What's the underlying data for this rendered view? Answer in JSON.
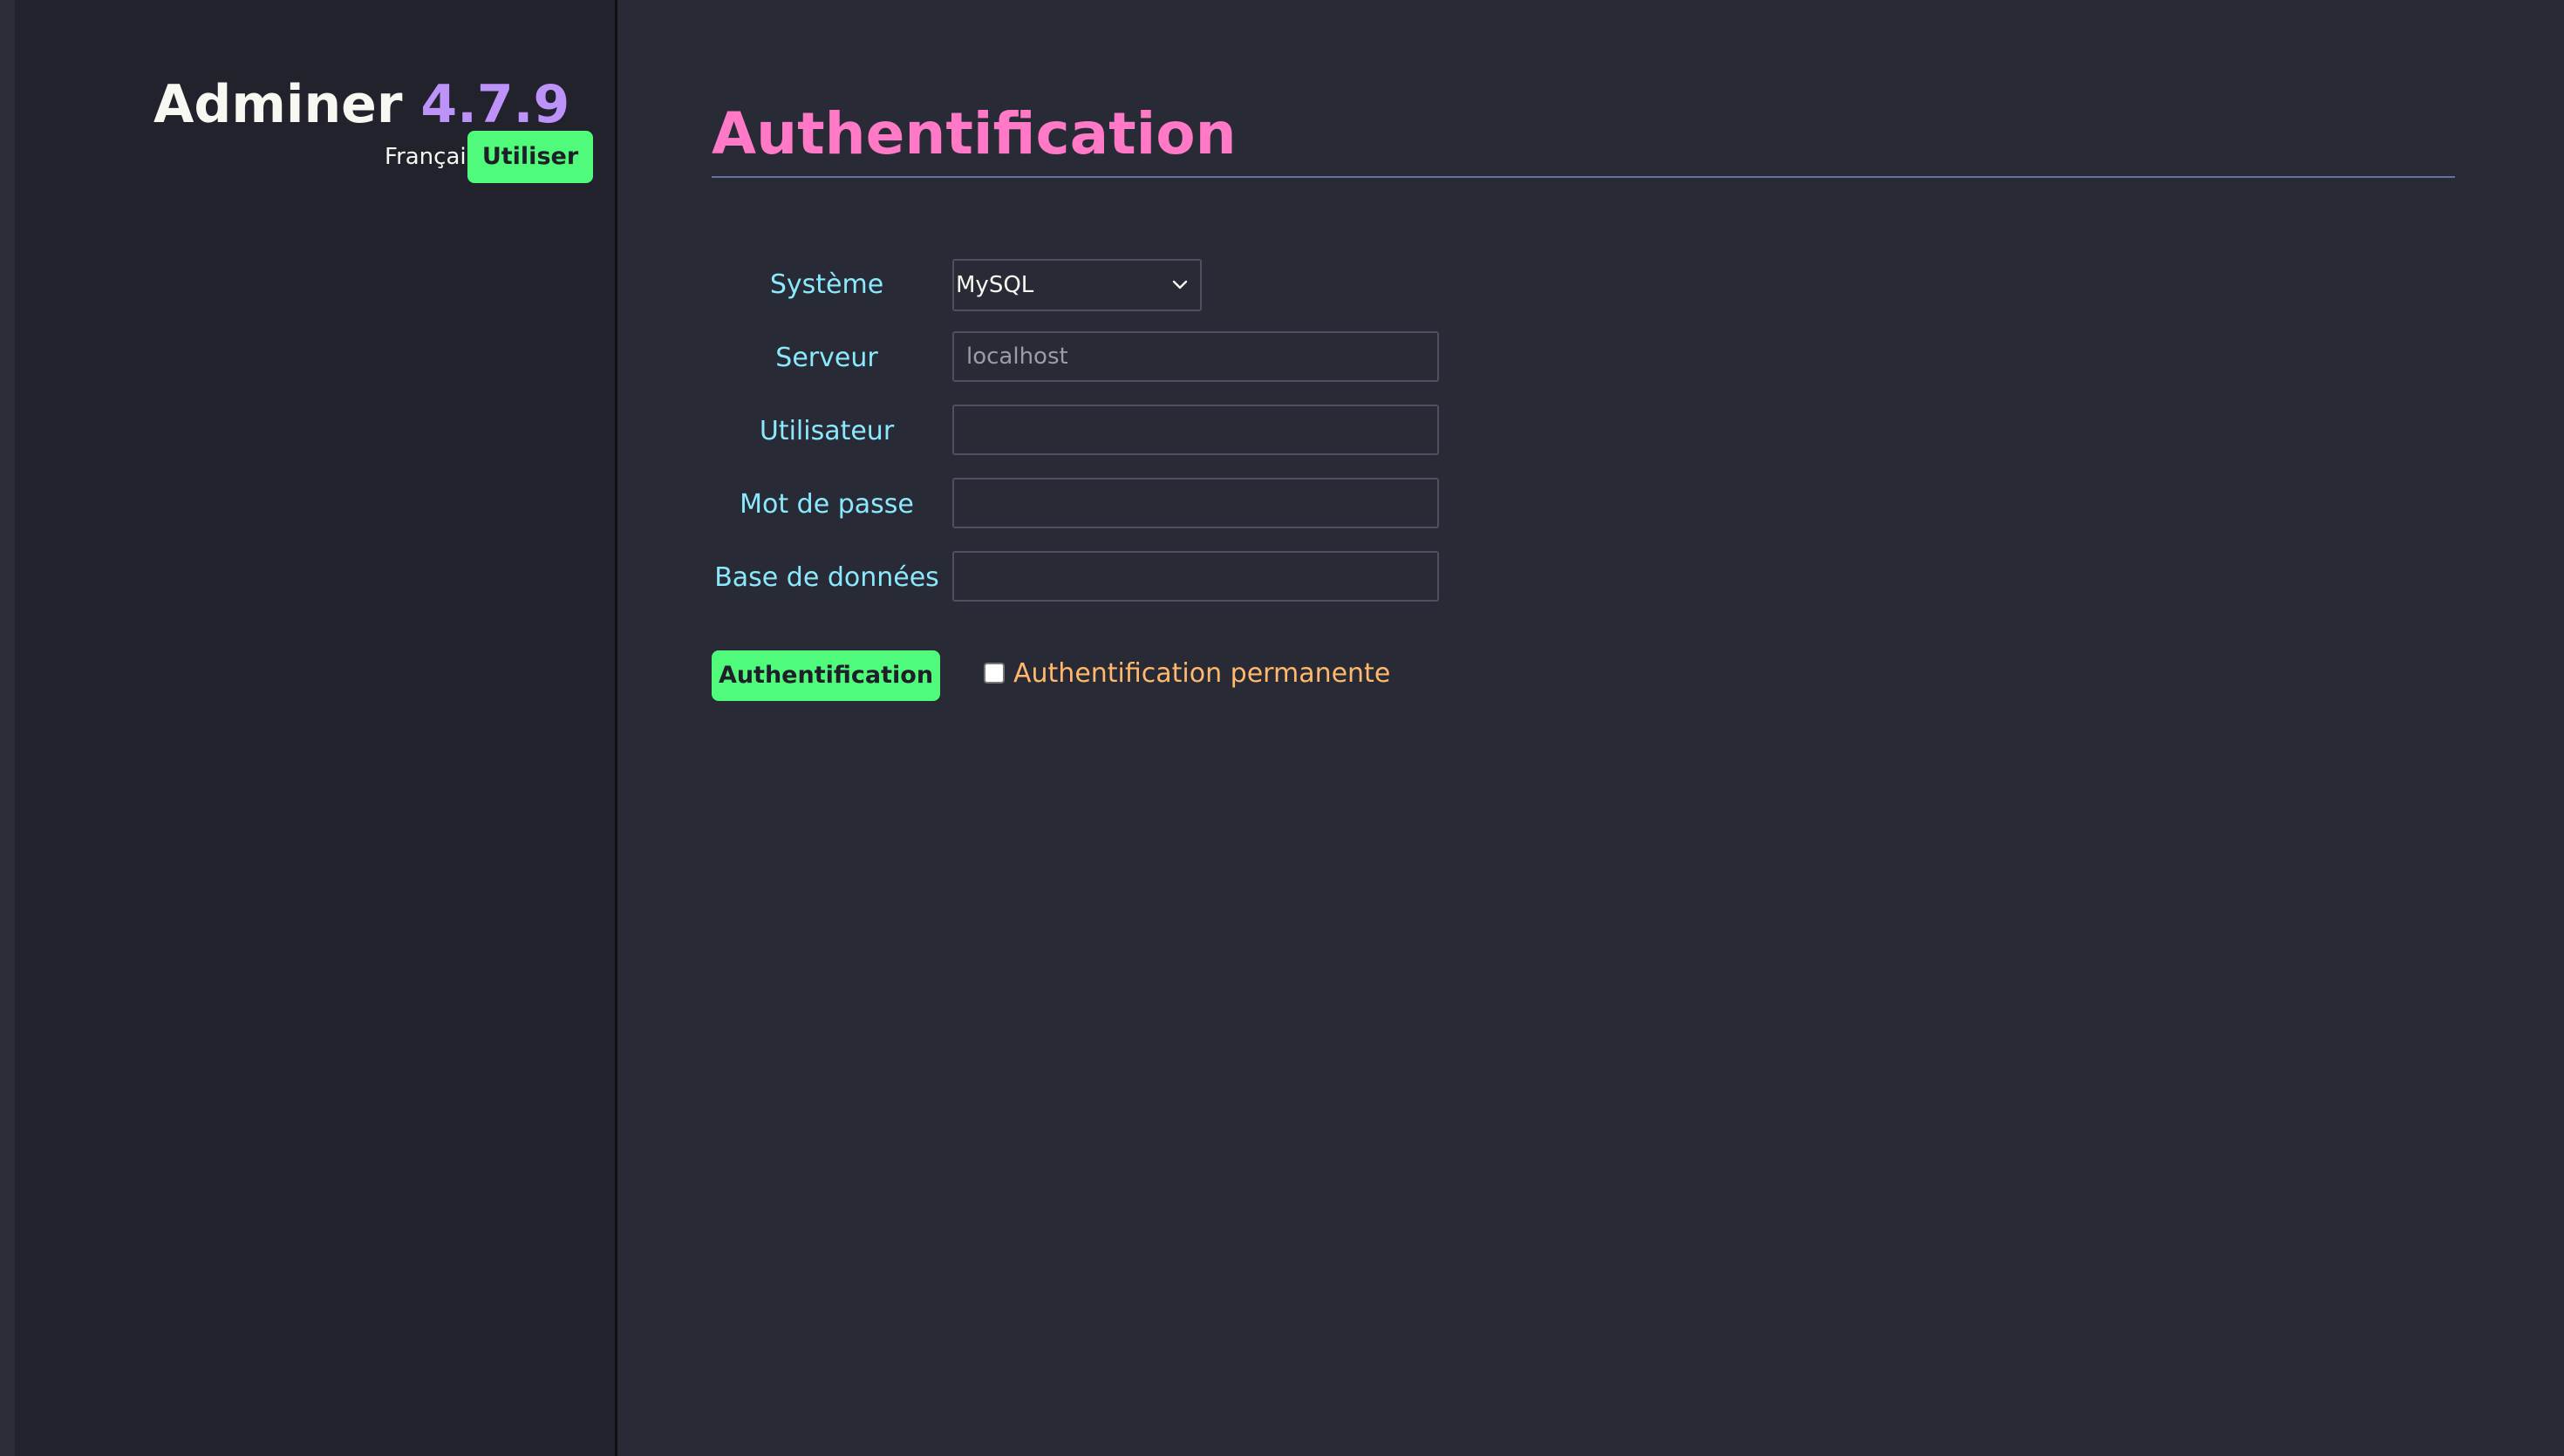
{
  "sidebar": {
    "brand_name": "Adminer",
    "brand_version": "4.7.9",
    "language": "Français",
    "language_button": "Utiliser"
  },
  "main": {
    "title": "Authentification",
    "form": {
      "system": {
        "label": "Système",
        "value": "MySQL",
        "icon": "chevron-down-icon"
      },
      "server": {
        "label": "Serveur",
        "placeholder": "localhost",
        "value": ""
      },
      "username": {
        "label": "Utilisateur",
        "value": ""
      },
      "password": {
        "label": "Mot de passe",
        "value": ""
      },
      "database": {
        "label": "Base de données",
        "value": ""
      },
      "submit_label": "Authentification",
      "permanent_login": {
        "label": "Authentification permanente",
        "checked": false
      }
    }
  },
  "colors": {
    "background": "#282a36",
    "sidebar": "#21222c",
    "accent_green": "#50fa7b",
    "title_pink": "#ff79c6",
    "version_purple": "#bd93f9",
    "label_cyan": "#8be9fd",
    "checkbox_label_orange": "#ffb86c",
    "rule": "#6272a4"
  }
}
